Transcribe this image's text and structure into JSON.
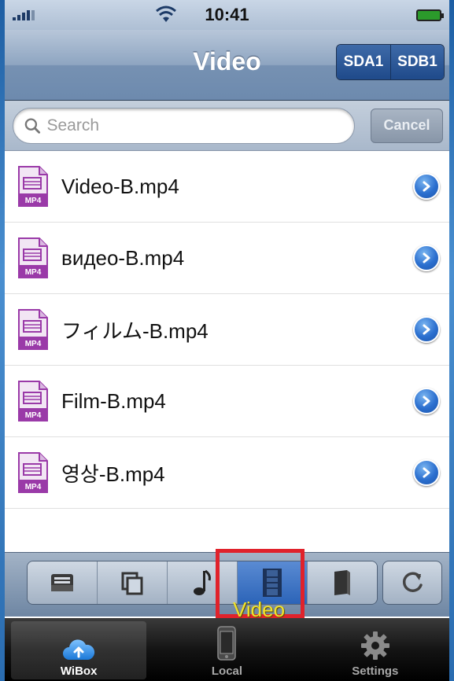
{
  "status_bar": {
    "time": "10:41"
  },
  "nav": {
    "title": "Video",
    "segments": [
      "SDA1",
      "SDB1"
    ]
  },
  "search": {
    "placeholder": "Search",
    "cancel_label": "Cancel"
  },
  "files": [
    {
      "name": "Video-B.mp4",
      "badge": "MP4"
    },
    {
      "name": "видео-B.mp4",
      "badge": "MP4"
    },
    {
      "name": "フィルム-B.mp4",
      "badge": "MP4"
    },
    {
      "name": "Film-B.mp4",
      "badge": "MP4"
    },
    {
      "name": "영상-B.mp4",
      "badge": "MP4"
    }
  ],
  "category_bar": {
    "icons": [
      "inbox-icon",
      "copy-icon",
      "music-note-icon",
      "film-icon",
      "book-icon"
    ],
    "active": "film-icon",
    "highlight_label": "Video"
  },
  "tabs": [
    {
      "label": "WiBox",
      "icon": "cloud-icon",
      "selected": true
    },
    {
      "label": "Local",
      "icon": "iphone-icon",
      "selected": false
    },
    {
      "label": "Settings",
      "icon": "gear-icon",
      "selected": false
    }
  ],
  "colors": {
    "highlight_border": "#e0222b",
    "highlight_text": "#f2e32a",
    "mp4_icon": "#9a3aa8",
    "segment_active": "#1f4a8a"
  }
}
